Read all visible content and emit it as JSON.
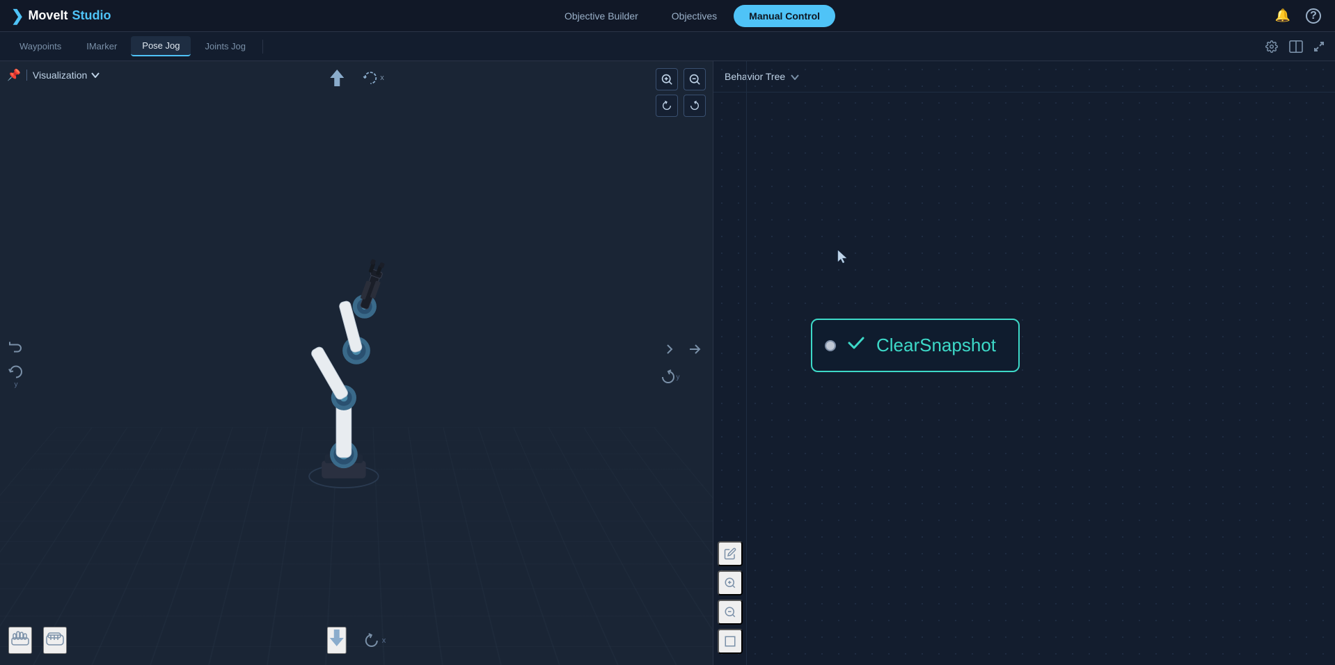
{
  "app": {
    "logo_arrow": "❯",
    "logo_moveit": "MoveIt",
    "logo_studio": " Studio"
  },
  "nav": {
    "objective_builder": "Objective Builder",
    "objectives": "Objectives",
    "manual_control": "Manual Control"
  },
  "tabs": {
    "waypoints": "Waypoints",
    "imarker": "IMarker",
    "pose_jog": "Pose Jog",
    "joints_jog": "Joints Jog"
  },
  "visualization": {
    "panel_label": "Visualization",
    "dropdown_label": "Visualization"
  },
  "behavior_tree": {
    "panel_title": "Behavior Tree",
    "node_title": "ClearSnapshot"
  },
  "icons": {
    "zoom_in": "🔍",
    "zoom_out": "🔍",
    "arrow_up": "↑",
    "rotate_x": "↺x",
    "rotate_ccw_z": "↺z",
    "rotate_cw_z": "↻z",
    "arrow_left": "↩",
    "rotate_left": "↺",
    "arrow_right": "↪",
    "arrow_down": "↓",
    "rotate_y": "↺y",
    "edit_icon": "✏",
    "zoom_in_panel": "+",
    "zoom_out_panel": "−",
    "fit_icon": "⊡",
    "bell": "🔔",
    "help": "?",
    "settings": "⚙",
    "split_view": "⊟",
    "pin": "📌",
    "check": "✓",
    "chevron_down": "▾",
    "hand_open": "✋",
    "hand_fist": "✊"
  }
}
